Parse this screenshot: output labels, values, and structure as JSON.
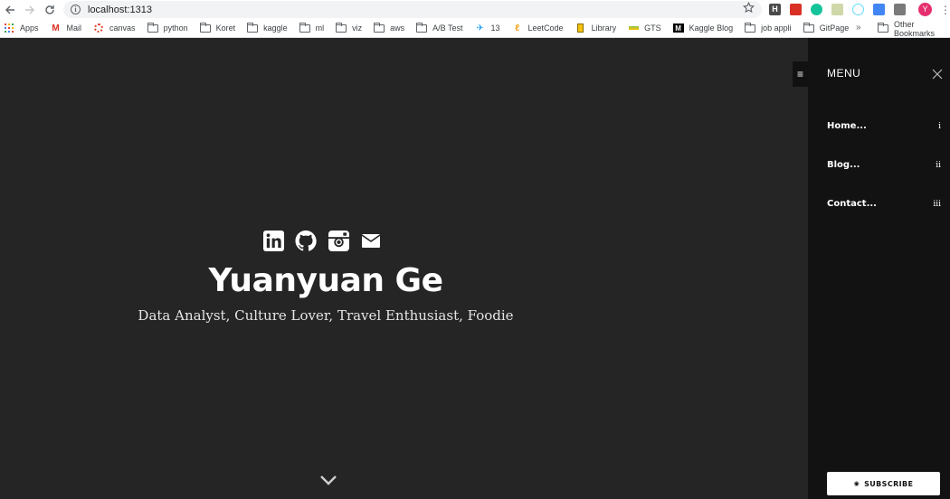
{
  "browser": {
    "url": "localhost:1313",
    "avatar_letter": "Y"
  },
  "bookmarks": {
    "items": [
      {
        "label": "Apps",
        "icon": "apps-grid-icon"
      },
      {
        "label": "Mail",
        "icon": "gmail-icon"
      },
      {
        "label": "canvas",
        "icon": "canvas-icon"
      },
      {
        "label": "python",
        "icon": "folder-icon"
      },
      {
        "label": "Koret",
        "icon": "folder-icon"
      },
      {
        "label": "kaggle",
        "icon": "folder-icon"
      },
      {
        "label": "ml",
        "icon": "folder-icon"
      },
      {
        "label": "viz",
        "icon": "folder-icon"
      },
      {
        "label": "aws",
        "icon": "folder-icon"
      },
      {
        "label": "A/B Test",
        "icon": "folder-icon"
      },
      {
        "label": "13",
        "icon": "bird-icon"
      },
      {
        "label": "LeetCode",
        "icon": "leetcode-icon"
      },
      {
        "label": "Library",
        "icon": "library-icon"
      },
      {
        "label": "GTS",
        "icon": "gts-icon"
      },
      {
        "label": "Kaggle Blog",
        "icon": "medium-icon"
      },
      {
        "label": "job appli",
        "icon": "folder-icon"
      },
      {
        "label": "GitPage",
        "icon": "folder-icon"
      }
    ],
    "overflow": "»",
    "other_label": "Other Bookmarks"
  },
  "hero": {
    "name": "Yuanyuan Ge",
    "tagline": "Data Analyst, Culture Lover, Travel Enthusiast, Foodie"
  },
  "sidebar": {
    "title": "MENU",
    "items": [
      {
        "label": "Home...",
        "num": "i"
      },
      {
        "label": "Blog...",
        "num": "ii"
      },
      {
        "label": "Contact...",
        "num": "iii"
      }
    ],
    "subscribe_label": "SUBSCRIBE"
  },
  "colors": {
    "page_bg": "#252525",
    "sidebar_bg": "#121212",
    "text": "#ffffff"
  }
}
